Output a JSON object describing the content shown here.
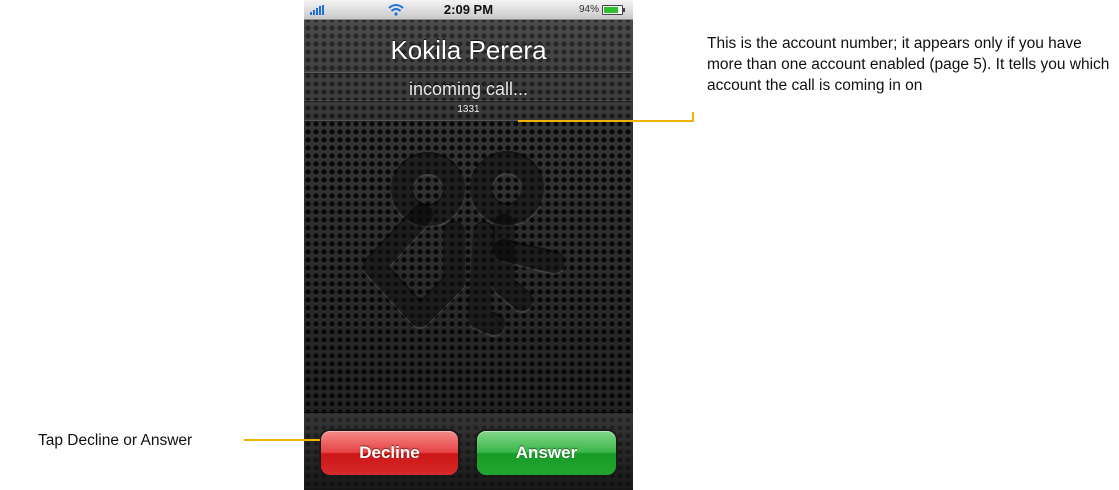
{
  "status_bar": {
    "time": "2:09 PM",
    "battery_text": "94%",
    "battery_level_percent": 94,
    "signal_icon": "signal-bars-icon",
    "wifi_icon": "wifi-icon"
  },
  "call": {
    "caller_name": "Kokila Perera",
    "status": "incoming call...",
    "account_number": "1331",
    "logo_icon": "app-logo-icon"
  },
  "buttons": {
    "decline_label": "Decline",
    "answer_label": "Answer",
    "decline_color": "#d62a2a",
    "answer_color": "#22a631"
  },
  "annotations": {
    "account_note": "This is the account number; it appears only if you have more than one account enabled (page 5). It tells you which account the call is coming in on",
    "buttons_note": "Tap Decline or Answer",
    "callout_color": "#f0b400"
  }
}
